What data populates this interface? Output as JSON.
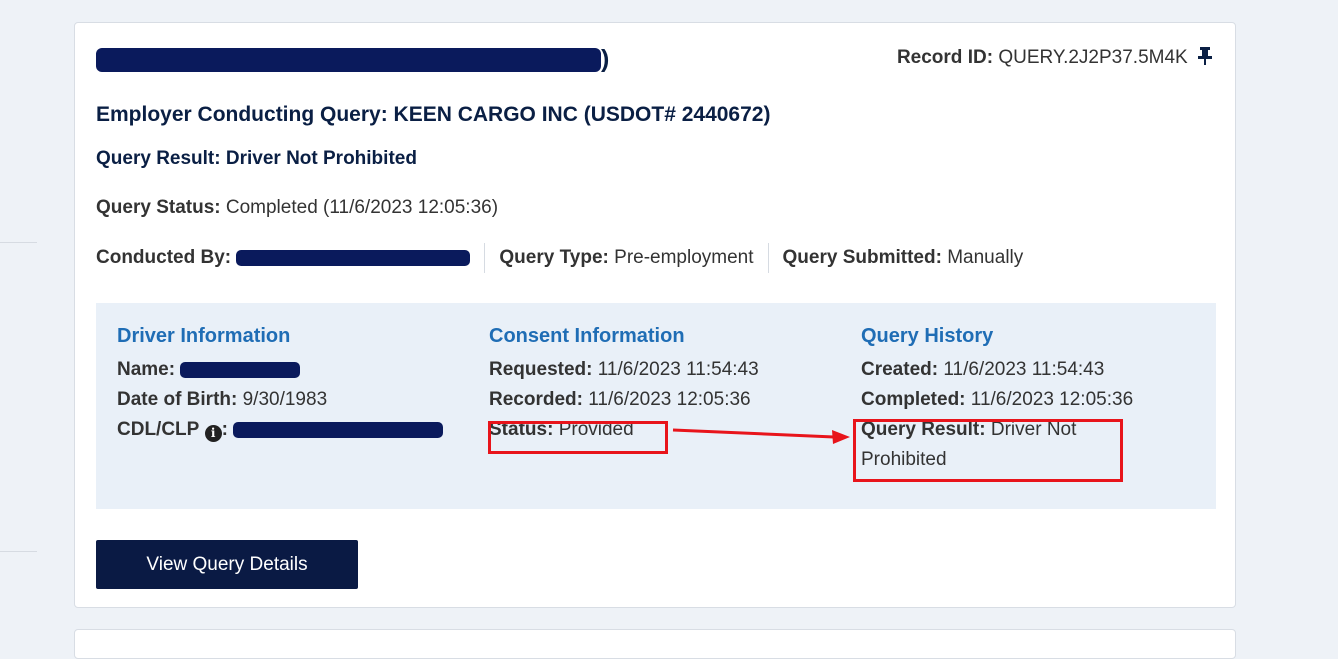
{
  "record": {
    "title_suffix": ")",
    "record_id_label": "Record ID:",
    "record_id_value": "QUERY.2J2P37.5M4K",
    "pin_icon": "pin-icon"
  },
  "employer": "Employer Conducting Query: KEEN CARGO INC (USDOT# 2440672)",
  "query_result_heading": "Query Result: Driver Not Prohibited",
  "status": {
    "label": "Query Status:",
    "value": "Completed (11/6/2023 12:05:36)"
  },
  "meta": {
    "conducted_by_label": "Conducted By:",
    "query_type_label": "Query Type:",
    "query_type_value": "Pre-employment",
    "submitted_label": "Query Submitted:",
    "submitted_value": "Manually"
  },
  "driver": {
    "heading": "Driver Information",
    "name_label": "Name:",
    "dob_label": "Date of Birth:",
    "dob_value": "9/30/1983",
    "cdl_label": "CDL/CLP",
    "cdl_colon": ":"
  },
  "consent": {
    "heading": "Consent Information",
    "requested_label": "Requested:",
    "requested_value": "11/6/2023 11:54:43",
    "recorded_label": "Recorded:",
    "recorded_value": "11/6/2023 12:05:36",
    "status_label": "Status:",
    "status_value": "Provided"
  },
  "history": {
    "heading": "Query History",
    "created_label": "Created:",
    "created_value": "11/6/2023 11:54:43",
    "completed_label": "Completed:",
    "completed_value": "11/6/2023 12:05:36",
    "result_label": "Query Result:",
    "result_value": "Driver Not Prohibited"
  },
  "button": {
    "view_details": "View Query Details"
  },
  "colors": {
    "navy": "#0a1a44",
    "heading_blue": "#1f6db5",
    "annotation_red": "#e8141b",
    "panel_bg": "#e9f0f8"
  }
}
